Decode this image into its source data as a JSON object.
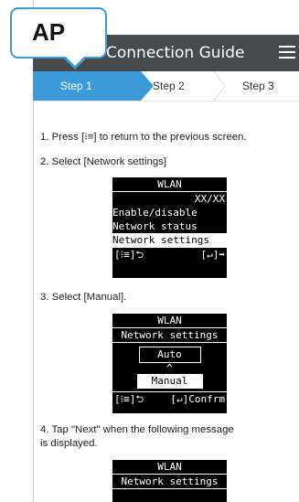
{
  "callout": {
    "label": "AP"
  },
  "header": {
    "title": "Connection Guide"
  },
  "steps": [
    {
      "label": "Step 1"
    },
    {
      "label": "Step 2"
    },
    {
      "label": "Step 3"
    }
  ],
  "instructions": {
    "i1": "1. Press [⁝≡] to return to the previous screen.",
    "i2": "2. Select [Network settings]",
    "i3": "3. Select [Manual].",
    "i4a": "4. Tap \"Next\" when the following message",
    "i4b": "is displayed."
  },
  "lcd1": {
    "title": "WLAN",
    "counter": "XX/XX",
    "item1": "Enable/disable",
    "item2": "Network status",
    "item3": "Network settings",
    "foot_left": "[⁝≡]⮌",
    "foot_right": "[↵]➡"
  },
  "lcd2": {
    "title": "WLAN",
    "subtitle": "Network settings",
    "opt_auto": "Auto",
    "caret": "^",
    "opt_manual": "Manual",
    "foot_left": "[⁝≡]⮌",
    "foot_right": "[↵]Confrm"
  },
  "lcd3": {
    "title": "WLAN",
    "subtitle": "Network settings"
  },
  "colors": {
    "accent": "#3d9ad8",
    "header_bg": "#474a4d"
  }
}
